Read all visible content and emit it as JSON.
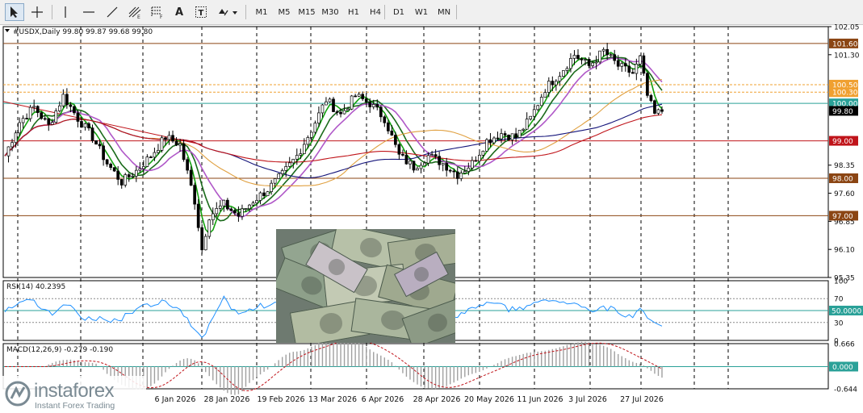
{
  "toolbar": {
    "timeframes": [
      "M1",
      "M5",
      "M15",
      "M30",
      "H1",
      "H4",
      "D1",
      "W1",
      "MN"
    ],
    "tools": [
      "cursor-icon",
      "crosshair-icon",
      "vertical-line-icon",
      "horizontal-line-icon",
      "trendline-icon",
      "fibonacci-icon",
      "fibonacci-fan-icon",
      "text-icon",
      "text-label-icon",
      "arrows-dropdown-icon"
    ],
    "text_tool_glyph": "A",
    "text_label_glyph": "T"
  },
  "chart_data": [
    {
      "type": "candlestick",
      "title": "#USDX,Daily  99.80 99.87 99.68 99.80",
      "symbol": "#USDX",
      "timeframe": "Daily",
      "ohlc_last": {
        "open": 99.8,
        "high": 99.87,
        "low": 99.68,
        "close": 99.8
      },
      "ylim": [
        95.35,
        102.05
      ],
      "y_tick_labels": [
        "102.05",
        "101.30",
        "98.35",
        "97.60",
        "96.85",
        "96.10",
        "95.35"
      ],
      "x_tick_labels": [
        "6 Jan 2026",
        "28 Jan 2026",
        "19 Feb 2026",
        "13 Mar 2026",
        "6 Apr 2026",
        "28 Apr 2026",
        "20 May 2026",
        "11 Jun 2026",
        "3 Jul 2026",
        "27 Jul 2026"
      ],
      "levels": [
        {
          "value": 101.6,
          "label": "101.60",
          "color": "#8b4513"
        },
        {
          "value": 100.5,
          "label": "100.50",
          "color": "#f0a030"
        },
        {
          "value": 100.3,
          "label": "100.30",
          "color": "#f0a030"
        },
        {
          "value": 100.0,
          "label": "100.00",
          "color": "#2aa198"
        },
        {
          "value": 99.0,
          "label": "99.00",
          "color": "#c0141a"
        },
        {
          "value": 98.0,
          "label": "98.00",
          "color": "#8b4513"
        },
        {
          "value": 97.0,
          "label": "97.00",
          "color": "#8b4513"
        }
      ],
      "current_price": {
        "value": 99.8,
        "label": "99.80"
      },
      "close_series_anchors": [
        [
          0,
          98.6
        ],
        [
          4,
          99.5
        ],
        [
          8,
          99.9
        ],
        [
          12,
          99.4
        ],
        [
          16,
          100.2
        ],
        [
          20,
          99.6
        ],
        [
          24,
          99.1
        ],
        [
          28,
          98.4
        ],
        [
          32,
          97.9
        ],
        [
          36,
          98.2
        ],
        [
          40,
          98.6
        ],
        [
          44,
          99.1
        ],
        [
          48,
          98.9
        ],
        [
          52,
          97.4
        ],
        [
          54,
          96.1
        ],
        [
          56,
          97.0
        ],
        [
          60,
          97.3
        ],
        [
          64,
          97.0
        ],
        [
          68,
          97.4
        ],
        [
          72,
          97.7
        ],
        [
          76,
          98.1
        ],
        [
          80,
          98.6
        ],
        [
          84,
          99.3
        ],
        [
          88,
          100.1
        ],
        [
          92,
          99.7
        ],
        [
          96,
          100.2
        ],
        [
          100,
          100.0
        ],
        [
          104,
          99.6
        ],
        [
          108,
          98.6
        ],
        [
          112,
          98.3
        ],
        [
          116,
          98.6
        ],
        [
          120,
          98.4
        ],
        [
          124,
          98.1
        ],
        [
          128,
          98.4
        ],
        [
          132,
          99.0
        ],
        [
          136,
          99.2
        ],
        [
          140,
          99.1
        ],
        [
          144,
          99.6
        ],
        [
          148,
          100.4
        ],
        [
          152,
          100.8
        ],
        [
          156,
          101.3
        ],
        [
          160,
          101.0
        ],
        [
          164,
          101.4
        ],
        [
          168,
          101.0
        ],
        [
          172,
          100.8
        ],
        [
          174,
          101.2
        ],
        [
          176,
          100.2
        ],
        [
          178,
          99.7
        ],
        [
          180,
          99.8
        ]
      ],
      "moving_averages": [
        {
          "name": "fast",
          "color": "#13a10e"
        },
        {
          "name": "medium",
          "color": "#1b6b1b"
        },
        {
          "name": "slow",
          "color": "#b058c8"
        },
        {
          "name": "trend",
          "color": "#e0a040"
        },
        {
          "name": "long",
          "color": "#14147a"
        },
        {
          "name": "longest",
          "color": "#c0141a"
        }
      ],
      "colors": {
        "bull": "#ffffff",
        "bear": "#000000",
        "wick": "#000000"
      }
    },
    {
      "type": "line",
      "title": "RSI(14) 40.2395",
      "indicator": "RSI",
      "period": 14,
      "last_value": 40.2395,
      "ylim": [
        0,
        100
      ],
      "y_tick_labels": [
        "100",
        "70",
        "30",
        "0"
      ],
      "level": {
        "value": 50,
        "label": "50.0000"
      },
      "dotted_levels": [
        70,
        30
      ],
      "color": "#1e90ff"
    },
    {
      "type": "bar",
      "title": "MACD(12,26,9) -0.279 -0.190",
      "indicator": "MACD",
      "params": [
        12,
        26,
        9
      ],
      "macd_value": -0.279,
      "signal_value": -0.19,
      "y_tick_labels": [
        "0.666",
        "-0.644"
      ],
      "ylim": [
        -0.644,
        0.666
      ],
      "zero_level": {
        "value": 0,
        "label": "0.000"
      },
      "histogram_color": "#a0a0a0",
      "signal_color": "#c0141a"
    }
  ],
  "watermark": {
    "brand": "instaforex",
    "tagline": "Instant Forex Trading"
  }
}
